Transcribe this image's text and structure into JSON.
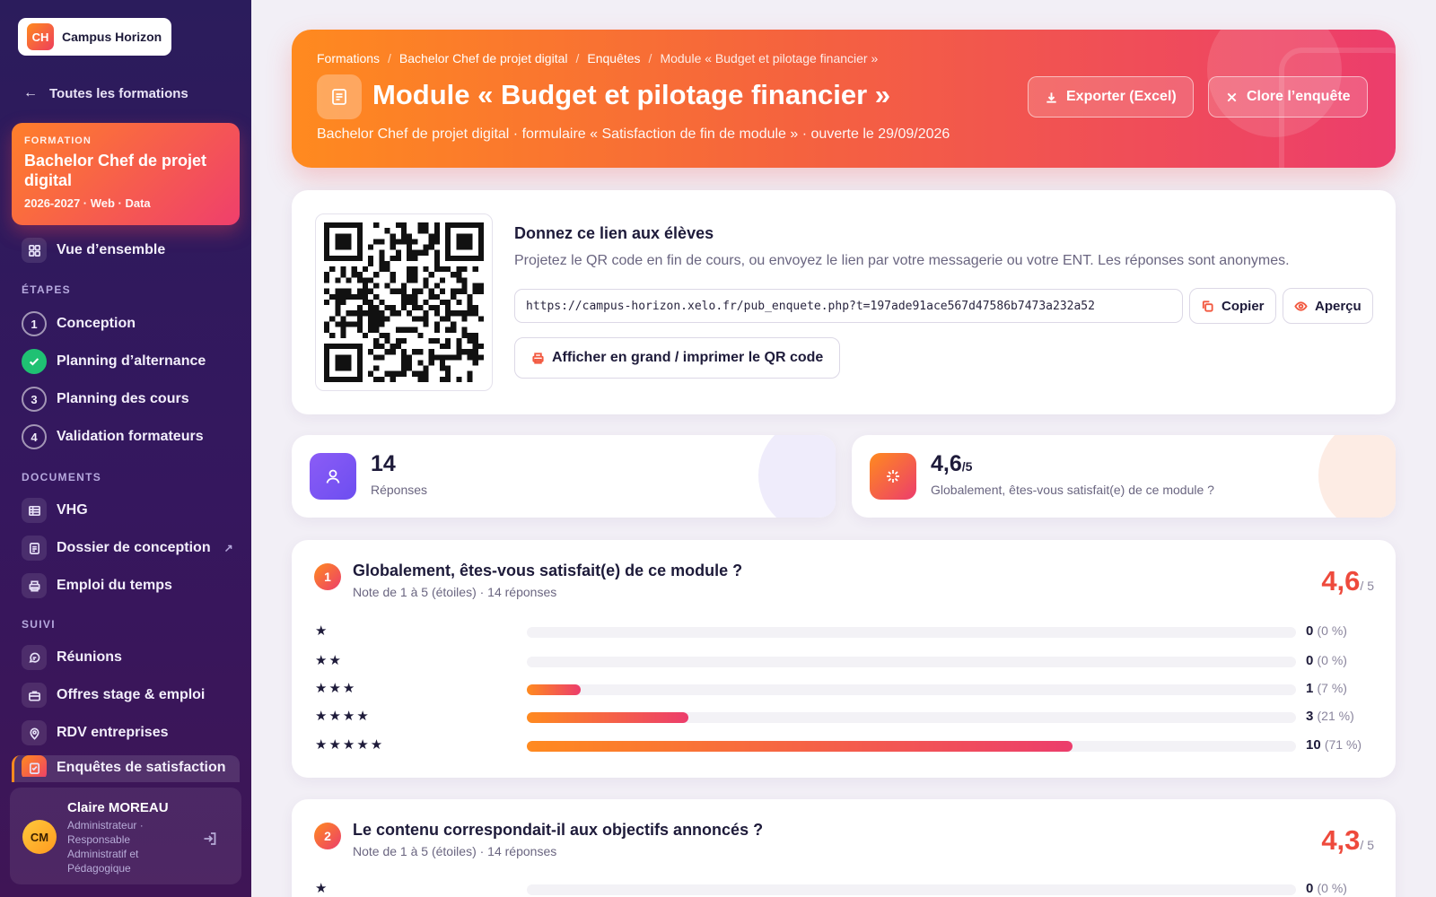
{
  "brand": {
    "logo": "CH",
    "name": "Campus Horizon"
  },
  "sidebar": {
    "back_label": "Toutes les formations",
    "formation": {
      "label": "FORMATION",
      "title": "Bachelor Chef de projet digital",
      "meta": "2026-2027 · Web · Data"
    },
    "overview": "Vue d’ensemble",
    "sections": {
      "steps": "ÉTAPES",
      "documents": "DOCUMENTS",
      "suivi": "SUIVI"
    },
    "steps": [
      {
        "num": "1",
        "label": "Conception",
        "done": false
      },
      {
        "num": "",
        "label": "Planning d’alternance",
        "done": true
      },
      {
        "num": "3",
        "label": "Planning des cours",
        "done": false
      },
      {
        "num": "4",
        "label": "Validation formateurs",
        "done": false
      }
    ],
    "documents": [
      {
        "label": "VHG",
        "icon": "table-icon"
      },
      {
        "label": "Dossier de conception",
        "icon": "document-icon",
        "external": "↗"
      },
      {
        "label": "Emploi du temps",
        "icon": "printer-icon"
      }
    ],
    "suivi": [
      {
        "label": "Réunions",
        "icon": "chat-icon"
      },
      {
        "label": "Offres stage & emploi",
        "icon": "briefcase-icon"
      },
      {
        "label": "RDV entreprises",
        "icon": "location-icon"
      },
      {
        "label": "Enquêtes de satisfaction",
        "icon": "survey-icon",
        "active": true
      }
    ],
    "user": {
      "initials": "CM",
      "name": "Claire MOREAU",
      "role": "Administrateur · Responsable Administratif et Pédagogique"
    }
  },
  "header": {
    "breadcrumb": [
      "Formations",
      "Bachelor Chef de projet digital",
      "Enquêtes",
      "Module « Budget et pilotage financier »"
    ],
    "title": "Module « Budget et pilotage financier »",
    "subtitle": "Bachelor Chef de projet digital · formulaire « Satisfaction de fin de module » · ouverte le 29/09/2026",
    "export_label": "Exporter (Excel)",
    "close_label": "Clore l’enquête"
  },
  "share": {
    "title": "Donnez ce lien aux élèves",
    "description": "Projetez le QR code en fin de cours, ou envoyez le lien par votre messagerie ou votre ENT. Les réponses sont anonymes.",
    "url": "https://campus-horizon.xelo.fr/pub_enquete.php?t=197ade91ace567d47586b7473a232a52",
    "copy_label": "Copier",
    "preview_label": "Aperçu",
    "print_label": "Afficher en grand / imprimer le QR code"
  },
  "stats": [
    {
      "value": "14",
      "unit": "",
      "label": "Réponses"
    },
    {
      "value": "4,6",
      "unit": "/5",
      "label": "Globalement, êtes-vous satisfait(e) de ce module ?"
    }
  ],
  "questions": [
    {
      "num": "1",
      "title": "Globalement, êtes-vous satisfait(e) de ce module ?",
      "sub": "Note de 1 à 5 (étoiles) · 14 réponses",
      "avg": "4,6",
      "avg_suffix": "/ 5",
      "rows": [
        {
          "stars": "★",
          "count": "0",
          "pct": "(0 %)",
          "fraction": 0
        },
        {
          "stars": "★★",
          "count": "0",
          "pct": "(0 %)",
          "fraction": 0
        },
        {
          "stars": "★★★",
          "count": "1",
          "pct": "(7 %)",
          "fraction": 0.07
        },
        {
          "stars": "★★★★",
          "count": "3",
          "pct": "(21 %)",
          "fraction": 0.21
        },
        {
          "stars": "★★★★★",
          "count": "10",
          "pct": "(71 %)",
          "fraction": 0.71
        }
      ]
    },
    {
      "num": "2",
      "title": "Le contenu correspondait-il aux objectifs annoncés ?",
      "sub": "Note de 1 à 5 (étoiles) · 14 réponses",
      "avg": "4,3",
      "avg_suffix": "/ 5",
      "rows": [
        {
          "stars": "★",
          "count": "0",
          "pct": "(0 %)",
          "fraction": 0
        }
      ]
    }
  ],
  "colors": {
    "accent_start": "#ff8a1f",
    "accent_end": "#ec3d6c",
    "sidebar": "#2b1c5c",
    "success": "#1fc173"
  }
}
